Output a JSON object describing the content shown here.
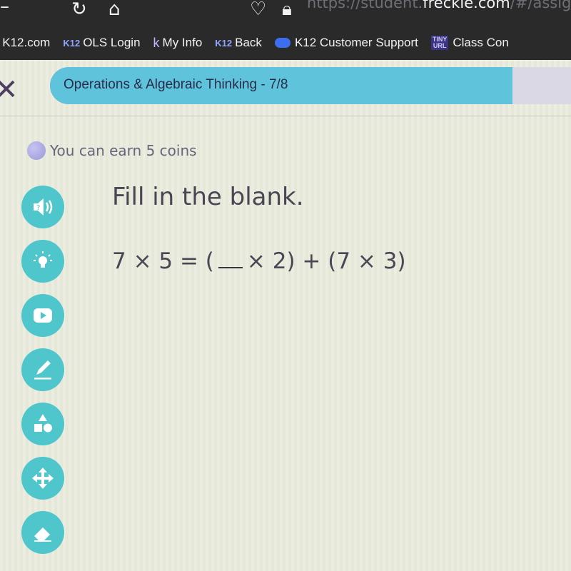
{
  "browser": {
    "url_prefix": "https://student.",
    "url_host": "freckle.com",
    "url_suffix": "/#/assig",
    "bookmarks": [
      {
        "tag": "K12",
        "label": "K12.com"
      },
      {
        "tag": "K12",
        "label": "OLS Login"
      },
      {
        "tag": "k",
        "label": "My Info"
      },
      {
        "tag": "K12",
        "label": "Back"
      },
      {
        "tag": "",
        "label": "K12 Customer Support"
      },
      {
        "tag": "TINY URL",
        "label": "Class Con"
      }
    ]
  },
  "header": {
    "progress_label": "Operations & Algebraic Thinking - 7/8",
    "progress_fraction": 0.875
  },
  "coins": {
    "text": "You can earn 5 coins"
  },
  "tools": [
    "audio-question",
    "hint",
    "video",
    "pencil",
    "shapes",
    "move",
    "eraser"
  ],
  "question": {
    "prompt": "Fill in the blank.",
    "equation_left": "7 × 5 = (",
    "equation_right": "× 2) + (7 × 3)"
  },
  "colors": {
    "accent": "#5ec3db",
    "tool": "#4ec6cc",
    "text": "#4b4654"
  }
}
